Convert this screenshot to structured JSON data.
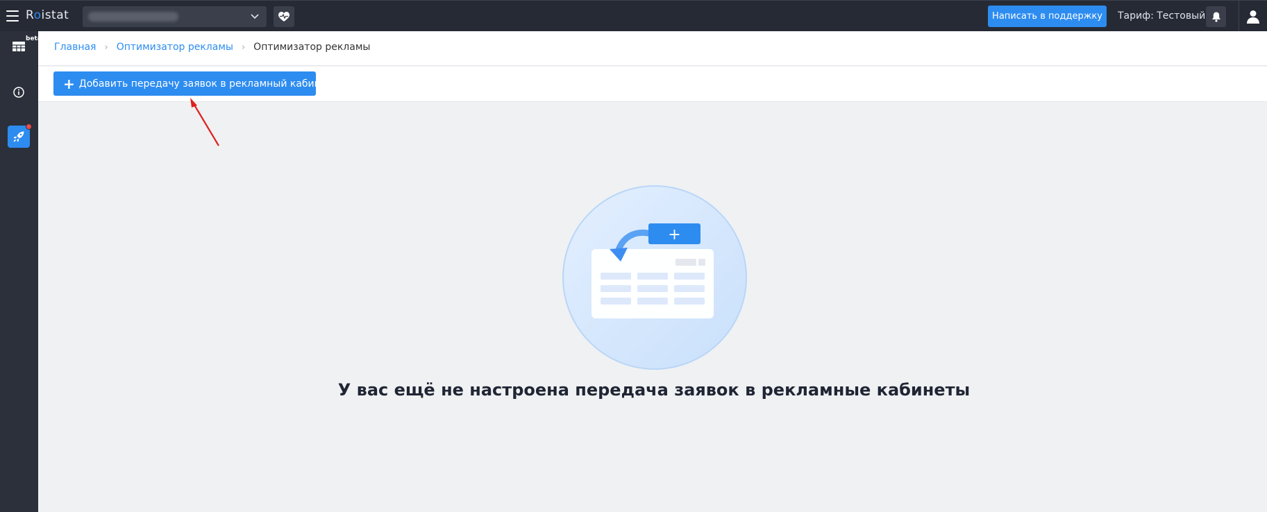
{
  "header": {
    "logo_text_left": "R",
    "logo_text_dot": "o",
    "logo_text_right": "istat",
    "support_button": "Написать в поддержку",
    "tariff_label": "Тариф: Тестовый"
  },
  "sidebar": {
    "beta_label": "beta"
  },
  "breadcrumb": {
    "items": [
      {
        "label": "Главная"
      },
      {
        "label": "Оптимизатор рекламы"
      }
    ],
    "current": "Оптимизатор рекламы"
  },
  "toolbar": {
    "add_button_label": "Добавить передачу заявок в рекламный кабинет"
  },
  "empty_state": {
    "message": "У вас ещё не настроена передача заявок в рекламные кабинеты",
    "illustration_button": "+"
  },
  "colors": {
    "accent": "#2d8cf0",
    "topbar": "#262a35",
    "sidebar": "#2b303b",
    "annotation": "#e02020"
  }
}
